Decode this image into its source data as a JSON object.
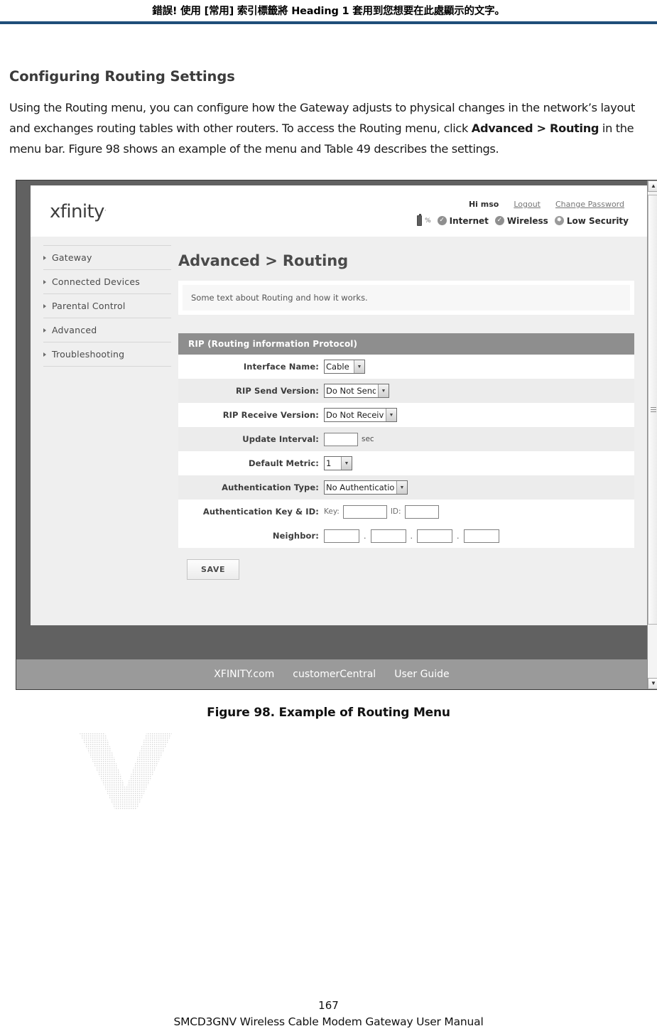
{
  "doc": {
    "running_header": "錯誤! 使用 [常用] 索引標籤將 Heading 1 套用到您想要在此處顯示的文字。",
    "section_title": "Configuring Routing Settings",
    "paragraph_part1": "Using the Routing menu, you can configure how the Gateway adjusts to physical changes in the network’s layout and exchanges routing tables with other routers. To access the Routing menu, click ",
    "paragraph_bold": "Advanced > Routing",
    "paragraph_part2": " in the menu bar. Figure 98 shows an example of the menu and Table 49 describes the settings.",
    "figure_caption": "Figure 98. Example of Routing Menu",
    "page_number": "167",
    "manual_title": "SMCD3GNV Wireless Cable Modem Gateway User Manual"
  },
  "screenshot": {
    "brand": {
      "logo": "xfinity",
      "tm": "."
    },
    "account": {
      "greeting": "Hi mso",
      "logout": "Logout",
      "change_password": "Change Password"
    },
    "status": {
      "battery_pct": "%",
      "internet": "Internet",
      "wireless": "Wireless",
      "security": "Low Security",
      "internet_icon": "check-circle-icon",
      "wireless_icon": "check-circle-icon",
      "security_icon": "warning-circle-icon",
      "battery_icon": "battery-icon"
    },
    "sidebar": {
      "items": [
        {
          "label": "Gateway"
        },
        {
          "label": "Connected Devices"
        },
        {
          "label": "Parental Control"
        },
        {
          "label": "Advanced"
        },
        {
          "label": "Troubleshooting"
        }
      ]
    },
    "main": {
      "title": "Advanced > Routing",
      "description": "Some text about Routing and how it works.",
      "panel_title": "RIP (Routing information Protocol)",
      "rows": [
        {
          "label": "Interface Name:",
          "value": "Cable"
        },
        {
          "label": "RIP Send Version:",
          "value": "Do Not Send"
        },
        {
          "label": "RIP Receive Version:",
          "value": "Do Not Receive"
        },
        {
          "label": "Update Interval:",
          "value": "",
          "unit": "sec"
        },
        {
          "label": "Default Metric:",
          "value": "1"
        },
        {
          "label": "Authentication Type:",
          "value": "No Authentication"
        }
      ],
      "auth_key_row": {
        "label": "Authentication Key & ID:",
        "key_label": "Key:",
        "key_value": "",
        "id_label": "ID:",
        "id_value": ""
      },
      "neighbor_row": {
        "label": "Neighbor:",
        "octets": [
          "",
          "",
          "",
          ""
        ],
        "separator": "."
      },
      "save_label": "SAVE"
    },
    "footer": {
      "links": [
        "XFINITY.com",
        "customerCentral",
        "User Guide"
      ]
    },
    "scrollbar": {
      "up": "▲",
      "down": "▼"
    }
  },
  "colors": {
    "header_rule": "#1f4e79",
    "panel_header": "#8e8e8e",
    "frame": "#616161",
    "footer_band": "#9a9a9a",
    "row_alt": "#ececec"
  }
}
